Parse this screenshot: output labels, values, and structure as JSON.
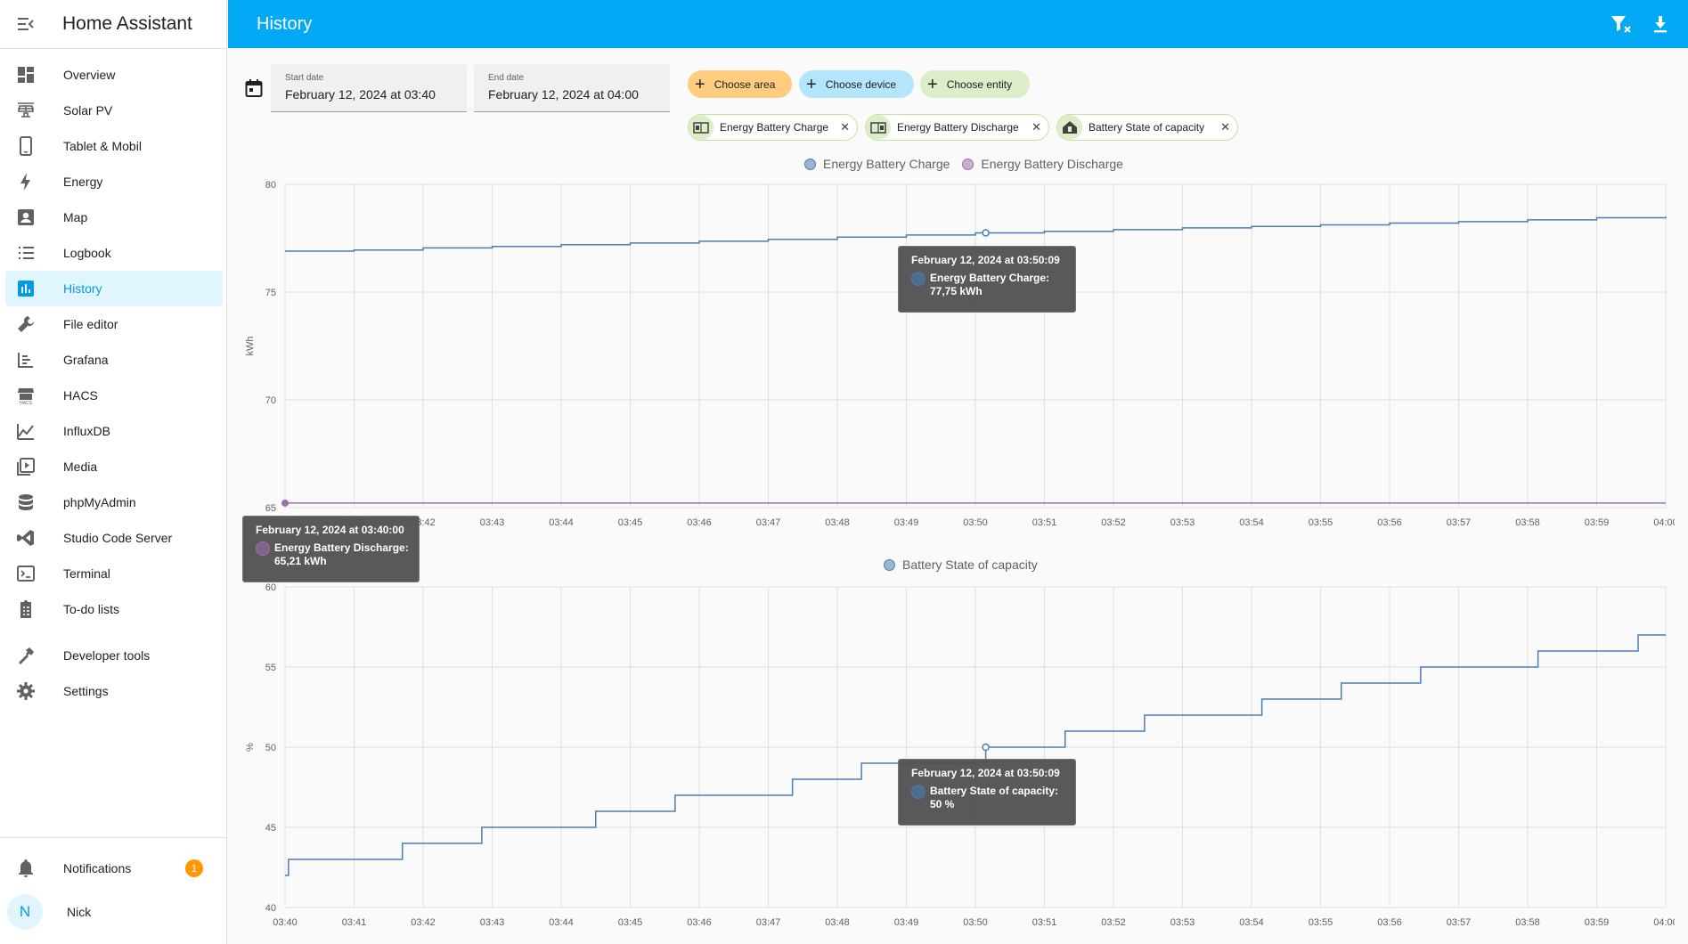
{
  "app": {
    "title": "Home Assistant"
  },
  "sidebar": {
    "items": [
      {
        "label": "Overview",
        "icon": "dashboard-icon"
      },
      {
        "label": "Solar PV",
        "icon": "solar-panel-icon"
      },
      {
        "label": "Tablet & Mobil",
        "icon": "tablet-icon"
      },
      {
        "label": "Energy",
        "icon": "lightning-bolt-icon"
      },
      {
        "label": "Map",
        "icon": "account-box-icon"
      },
      {
        "label": "Logbook",
        "icon": "format-list-icon"
      },
      {
        "label": "History",
        "icon": "chart-box-icon"
      },
      {
        "label": "File editor",
        "icon": "wrench-icon"
      },
      {
        "label": "Grafana",
        "icon": "chart-timeline-icon"
      },
      {
        "label": "HACS",
        "icon": "hacs-store-icon"
      },
      {
        "label": "InfluxDB",
        "icon": "chart-areaspline-icon"
      },
      {
        "label": "Media",
        "icon": "play-box-icon"
      },
      {
        "label": "phpMyAdmin",
        "icon": "database-icon"
      },
      {
        "label": "Studio Code Server",
        "icon": "vscode-icon"
      },
      {
        "label": "Terminal",
        "icon": "console-icon"
      },
      {
        "label": "To-do lists",
        "icon": "clipboard-list-icon"
      }
    ],
    "developer_tools": "Developer tools",
    "settings": "Settings",
    "notifications": "Notifications",
    "notifications_count": "1",
    "user_initial": "N",
    "user_name": "Nick"
  },
  "topbar": {
    "title": "History",
    "filter_icon": "filter-remove-icon",
    "download_icon": "download-icon"
  },
  "filters": {
    "start_label": "Start date",
    "start_value": "February 12, 2024 at 03:40",
    "end_label": "End date",
    "end_value": "February 12, 2024 at 04:00",
    "choose_area": "Choose area",
    "choose_device": "Choose device",
    "choose_entity": "Choose entity",
    "area_color": "#ffcc80",
    "device_color": "#b3e5fc",
    "entity_color": "#dcedc8",
    "entities": [
      {
        "label": "Energy Battery Charge",
        "icon": "home-battery-icon"
      },
      {
        "label": "Energy Battery Discharge",
        "icon": "home-battery-icon"
      },
      {
        "label": "Battery State of capacity",
        "icon": "home-battery-outline-icon"
      }
    ]
  },
  "chart_data": [
    {
      "type": "line",
      "ylabel": "kWh",
      "ylim": [
        65,
        80
      ],
      "yticks": [
        65,
        70,
        75,
        80
      ],
      "xticks": [
        "03:40",
        "03:41",
        "03:42",
        "03:43",
        "03:44",
        "03:45",
        "03:46",
        "03:47",
        "03:48",
        "03:49",
        "03:50",
        "03:51",
        "03:52",
        "03:53",
        "03:54",
        "03:55",
        "03:56",
        "03:57",
        "03:58",
        "03:59",
        "04:00"
      ],
      "grid": true,
      "legend_position": "top-center",
      "series": [
        {
          "name": "Energy Battery Charge",
          "color": "#4a7eb0",
          "x": [
            "03:40",
            "03:41",
            "03:42",
            "03:43",
            "03:44",
            "03:45",
            "03:46",
            "03:47",
            "03:48",
            "03:49",
            "03:50",
            "03:51",
            "03:52",
            "03:53",
            "03:54",
            "03:55",
            "03:56",
            "03:57",
            "03:58",
            "03:59",
            "04:00"
          ],
          "values": [
            76.9,
            76.95,
            77.05,
            77.12,
            77.2,
            77.28,
            77.36,
            77.45,
            77.55,
            77.65,
            77.75,
            77.82,
            77.9,
            77.98,
            78.05,
            78.12,
            78.2,
            78.27,
            78.35,
            78.45,
            78.5
          ]
        },
        {
          "name": "Energy Battery Discharge",
          "color": "#9c6fae",
          "x": [
            "03:40",
            "04:00"
          ],
          "values": [
            65.21,
            65.21
          ]
        }
      ],
      "tooltips": [
        {
          "title": "February 12, 2024 at 03:50:09",
          "text": "Energy Battery Charge: 77,75 kWh",
          "series": 0
        },
        {
          "title": "February 12, 2024 at 03:40:00",
          "text": "Energy Battery Discharge: 65,21 kWh",
          "series": 1
        }
      ]
    },
    {
      "type": "line",
      "ylabel": "%",
      "ylim": [
        40,
        60
      ],
      "yticks": [
        40,
        45,
        50,
        55,
        60
      ],
      "xticks": [
        "03:40",
        "03:41",
        "03:42",
        "03:43",
        "03:44",
        "03:45",
        "03:46",
        "03:47",
        "03:48",
        "03:49",
        "03:50",
        "03:51",
        "03:52",
        "03:53",
        "03:54",
        "03:55",
        "03:56",
        "03:57",
        "03:58",
        "03:59",
        "04:00"
      ],
      "grid": true,
      "legend_position": "top-center",
      "series": [
        {
          "name": "Battery State of capacity",
          "color": "#4a7eb0",
          "step": true,
          "x": [
            0.0,
            0.05,
            1.7,
            2.85,
            4.5,
            5.65,
            7.35,
            8.35,
            9.65,
            10.15,
            11.3,
            12.45,
            14.15,
            15.3,
            16.45,
            18.15,
            19.6,
            20.0
          ],
          "values": [
            42,
            43,
            44,
            45,
            46,
            47,
            48,
            49,
            49,
            50,
            51,
            52,
            53,
            54,
            55,
            56,
            57,
            57
          ]
        }
      ],
      "tooltips": [
        {
          "title": "February 12, 2024 at 03:50:09",
          "text": "Battery State of capacity: 50 %",
          "series": 0
        }
      ]
    }
  ]
}
